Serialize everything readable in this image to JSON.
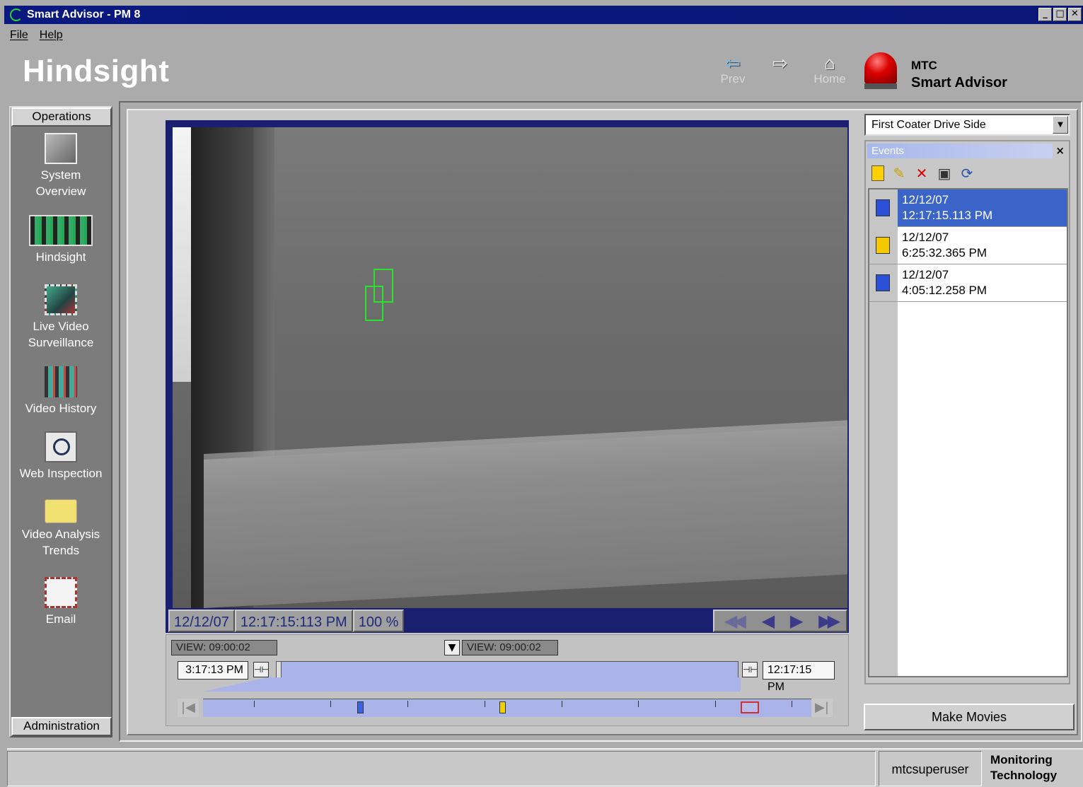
{
  "window": {
    "title": "Smart Advisor - PM 8",
    "buttons": [
      "_",
      "□",
      "✕"
    ]
  },
  "menu": [
    "File",
    "Help"
  ],
  "header": {
    "brand": "Hindsight",
    "prev_label": "Prev",
    "next_label": "",
    "home_label": "Home",
    "company_line1": "MTC",
    "company_line2": "Smart Advisor"
  },
  "sidebar": {
    "top_button": "Operations",
    "bottom_button": "Administration",
    "items": [
      {
        "label": "System Overview",
        "icon": "system-overview-icon"
      },
      {
        "label": "Hindsight",
        "icon": "film-strip-icon"
      },
      {
        "label": "Live Video Surveillance",
        "icon": "live-video-icon"
      },
      {
        "label": "Video History",
        "icon": "video-history-icon"
      },
      {
        "label": "Web Inspection",
        "icon": "magnifier-icon"
      },
      {
        "label": "Video Analysis Trends",
        "icon": "folder-icon"
      },
      {
        "label": "Email",
        "icon": "email-icon"
      }
    ]
  },
  "video": {
    "date": "12/12/07",
    "time": "12:17:15:113 PM",
    "zoom": "100 %"
  },
  "timeline": {
    "view_left": "VIEW: 09:00:02",
    "view_mid": "VIEW: 09:00:02",
    "start_time": "3:17:13 PM",
    "end_time": "12:17:15 PM",
    "markers": [
      {
        "color": "#3a64e0",
        "kind": "event"
      },
      {
        "color": "#f0d000",
        "kind": "event"
      },
      {
        "color": "#3a64e0",
        "kind": "current"
      }
    ]
  },
  "camera_select": {
    "value": "First Coater Drive Side"
  },
  "events": {
    "title": "Events",
    "close": "×",
    "tools": [
      "new-event-icon",
      "edit-event-icon",
      "delete-event-icon",
      "properties-icon",
      "refresh-icon"
    ],
    "items": [
      {
        "date": "12/12/07",
        "time": "12:17:15.113 PM",
        "color": "#2a50d8",
        "selected": true
      },
      {
        "date": "12/12/07",
        "time": "6:25:32.365 PM",
        "color": "#f5c800",
        "selected": false
      },
      {
        "date": "12/12/07",
        "time": "4:05:12.258 PM",
        "color": "#2a50d8",
        "selected": false
      }
    ]
  },
  "make_movies_label": "Make Movies",
  "status": {
    "user": "mtcsuperuser",
    "company_line1": "Monitoring",
    "company_line2": "Technology"
  },
  "colors": {
    "titlebar": "#0a1980",
    "selection": "#3a64c8",
    "timeline_fill": "#aab4e8"
  }
}
